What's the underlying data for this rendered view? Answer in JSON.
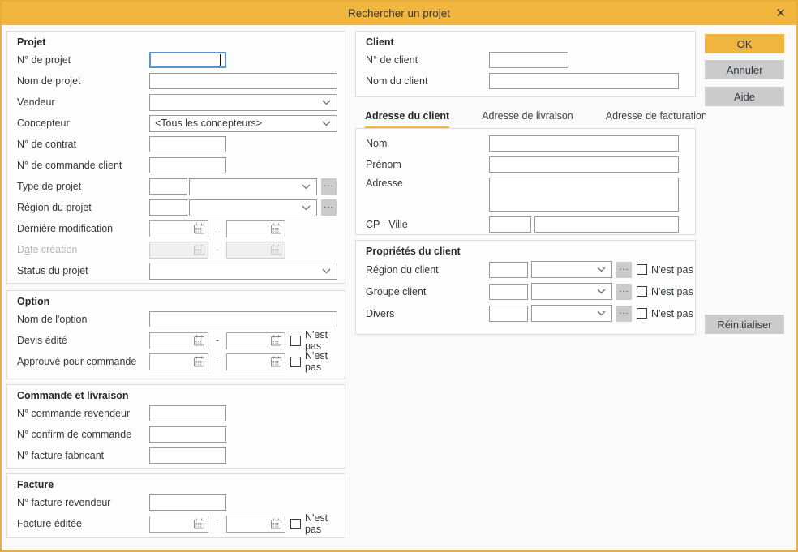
{
  "window": {
    "title": "Rechercher un projet",
    "close": "✕"
  },
  "labels": {
    "more": "...",
    "range_sep": "-",
    "not": "N'est pas"
  },
  "colors": {
    "accent": "#f2b63f",
    "focus": "#5795d6",
    "border": "#e9ae3d"
  },
  "buttons": {
    "ok": {
      "key": "O",
      "post": "K"
    },
    "cancel": {
      "key": "A",
      "post": "nnuler"
    },
    "help": {
      "label": "Aide"
    },
    "reset": {
      "label": "Réinitialiser"
    }
  },
  "projet": {
    "title": "Projet",
    "no_projet": "N° de projet",
    "nom_projet": "Nom de projet",
    "vendeur": "Vendeur",
    "concepteur": "Concepteur",
    "concepteur_value": "<Tous les concepteurs>",
    "no_contrat": "N° de contrat",
    "no_commande_client": "N° de commande client",
    "type_projet": "Type de projet",
    "region_projet": "Région du projet",
    "derniere_modification": {
      "key": "D",
      "post": "ernière modification"
    },
    "date_creation": {
      "pre": "D",
      "key": "a",
      "post": "te création"
    },
    "status_projet": "Status du projet"
  },
  "option": {
    "title": "Option",
    "nom_option": "Nom de l'option",
    "devis_edite": "Devis édité",
    "approuve": "Approuvé pour commande"
  },
  "commande": {
    "title": "Commande et livraison",
    "no_commande_revendeur": "N° commande revendeur",
    "no_confirm": "N° confirm de commande",
    "no_facture_fabricant": "N° facture fabricant"
  },
  "facture": {
    "title": "Facture",
    "no_facture_revendeur": "N° facture revendeur",
    "facture_editee": "Facture éditée"
  },
  "client": {
    "title": "Client",
    "no_client": "N° de client",
    "nom_client": "Nom du client"
  },
  "tabs": {
    "adresse_client": "Adresse du client",
    "adresse_livraison": "Adresse de livraison",
    "adresse_facturation": "Adresse de facturation"
  },
  "adresse": {
    "nom": "Nom",
    "prenom": "Prénom",
    "adresse": "Adresse",
    "cp_ville": "CP - Ville"
  },
  "proprietes": {
    "title": "Propriétés du client",
    "region_client": "Région du client",
    "groupe_client": "Groupe client",
    "divers": "Divers"
  }
}
